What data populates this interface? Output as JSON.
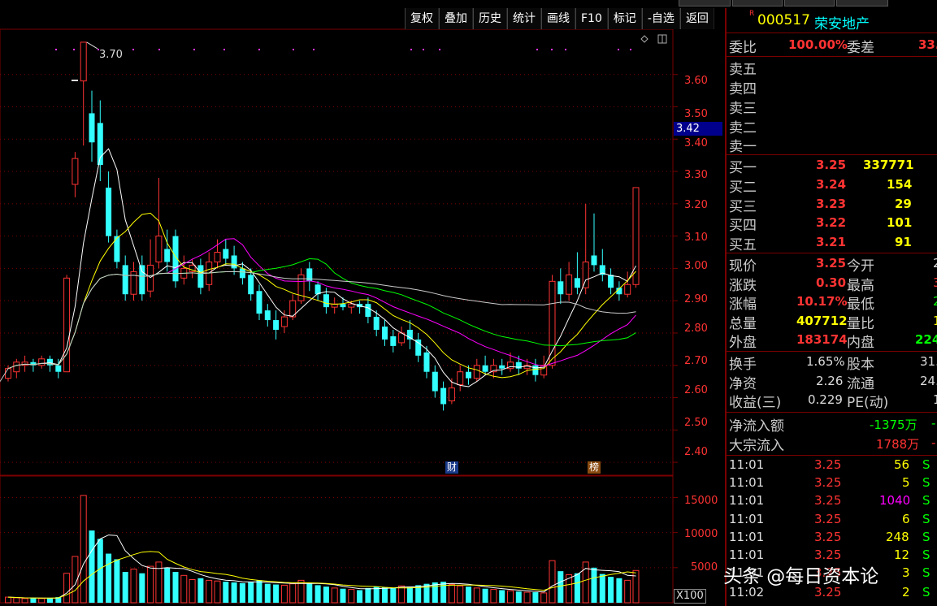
{
  "toolbar": {
    "items": [
      "复权",
      "叠加",
      "历史",
      "统计",
      "画线",
      "F10",
      "标记",
      "-自选",
      "返回"
    ]
  },
  "chart_data": {
    "type": "candlestick",
    "title": "",
    "price_axis": {
      "ticks": [
        "3.60",
        "3.50",
        "3.40",
        "3.30",
        "3.20",
        "3.10",
        "3.00",
        "2.90",
        "2.80",
        "2.70",
        "2.60",
        "2.50",
        "2.40"
      ],
      "range": [
        2.36,
        3.73
      ]
    },
    "volume_axis": {
      "ticks": [
        "15000",
        "10000",
        "5000"
      ],
      "multiplier_label": "X100",
      "range": [
        0,
        17600
      ]
    },
    "current_price_label": "3.42",
    "high_marker": "3.70",
    "event_badges": [
      {
        "label": "财",
        "index": 53,
        "color": "#1a3a8a"
      },
      {
        "label": "榜",
        "index": 70,
        "color": "#8a4a10"
      }
    ],
    "candles": [
      [
        2.66,
        2.69,
        2.7,
        2.65
      ],
      [
        2.68,
        2.71,
        2.72,
        2.66
      ],
      [
        2.7,
        2.71,
        2.73,
        2.68
      ],
      [
        2.71,
        2.7,
        2.72,
        2.68
      ],
      [
        2.7,
        2.72,
        2.73,
        2.69
      ],
      [
        2.72,
        2.7,
        2.73,
        2.68
      ],
      [
        2.7,
        2.68,
        2.72,
        2.66
      ],
      [
        2.68,
        2.97,
        2.98,
        2.68
      ],
      [
        3.26,
        3.34,
        3.36,
        3.22
      ],
      [
        3.58,
        3.7,
        3.7,
        3.38
      ],
      [
        3.48,
        3.39,
        3.55,
        3.33
      ],
      [
        3.45,
        3.32,
        3.52,
        3.27
      ],
      [
        3.25,
        3.1,
        3.3,
        3.08
      ],
      [
        3.1,
        3.02,
        3.12,
        3.0
      ],
      [
        3.01,
        2.92,
        3.04,
        2.9
      ],
      [
        2.92,
        2.99,
        3.02,
        2.9
      ],
      [
        3.01,
        2.92,
        3.04,
        2.9
      ],
      [
        2.93,
        3.01,
        3.09,
        2.91
      ],
      [
        3.02,
        3.1,
        3.28,
        3.0
      ],
      [
        3.06,
        3.02,
        3.12,
        2.99
      ],
      [
        3.1,
        2.96,
        3.12,
        2.94
      ],
      [
        2.97,
        3.0,
        3.04,
        2.95
      ],
      [
        2.99,
        3.01,
        3.03,
        2.97
      ],
      [
        3.01,
        2.94,
        3.03,
        2.92
      ],
      [
        2.95,
        3.02,
        3.05,
        2.93
      ],
      [
        3.02,
        3.05,
        3.09,
        3.0
      ],
      [
        3.06,
        3.03,
        3.09,
        3.01
      ],
      [
        3.04,
        3.0,
        3.07,
        2.98
      ],
      [
        3.0,
        2.97,
        3.02,
        2.95
      ],
      [
        2.98,
        2.92,
        3.0,
        2.9
      ],
      [
        2.93,
        2.86,
        2.95,
        2.84
      ],
      [
        2.87,
        2.84,
        2.89,
        2.82
      ],
      [
        2.84,
        2.81,
        2.87,
        2.78
      ],
      [
        2.82,
        2.85,
        2.87,
        2.8
      ],
      [
        2.85,
        2.9,
        2.92,
        2.84
      ],
      [
        2.9,
        2.98,
        3.0,
        2.89
      ],
      [
        3.0,
        2.96,
        3.02,
        2.93
      ],
      [
        2.95,
        2.92,
        2.96,
        2.9
      ],
      [
        2.92,
        2.88,
        2.94,
        2.86
      ],
      [
        2.88,
        2.89,
        2.91,
        2.86
      ],
      [
        2.89,
        2.88,
        2.91,
        2.87
      ],
      [
        2.88,
        2.89,
        2.9,
        2.86
      ],
      [
        2.89,
        2.88,
        2.9,
        2.86
      ],
      [
        2.89,
        2.85,
        2.91,
        2.83
      ],
      [
        2.85,
        2.81,
        2.87,
        2.79
      ],
      [
        2.82,
        2.78,
        2.84,
        2.76
      ],
      [
        2.79,
        2.76,
        2.81,
        2.74
      ],
      [
        2.77,
        2.8,
        2.82,
        2.76
      ],
      [
        2.81,
        2.78,
        2.84,
        2.75
      ],
      [
        2.78,
        2.73,
        2.8,
        2.71
      ],
      [
        2.74,
        2.68,
        2.76,
        2.66
      ],
      [
        2.68,
        2.62,
        2.7,
        2.6
      ],
      [
        2.63,
        2.58,
        2.65,
        2.56
      ],
      [
        2.59,
        2.63,
        2.66,
        2.58
      ],
      [
        2.64,
        2.68,
        2.7,
        2.62
      ],
      [
        2.68,
        2.66,
        2.7,
        2.64
      ],
      [
        2.66,
        2.7,
        2.72,
        2.65
      ],
      [
        2.7,
        2.68,
        2.73,
        2.67
      ],
      [
        2.68,
        2.7,
        2.72,
        2.66
      ],
      [
        2.7,
        2.69,
        2.72,
        2.67
      ],
      [
        2.69,
        2.71,
        2.74,
        2.68
      ],
      [
        2.71,
        2.69,
        2.73,
        2.67
      ],
      [
        2.69,
        2.7,
        2.72,
        2.67
      ],
      [
        2.7,
        2.67,
        2.72,
        2.65
      ],
      [
        2.67,
        2.7,
        2.73,
        2.66
      ],
      [
        2.7,
        2.96,
        2.98,
        2.69
      ],
      [
        2.96,
        2.92,
        3.0,
        2.89
      ],
      [
        2.92,
        2.98,
        3.02,
        2.9
      ],
      [
        2.97,
        2.94,
        3.05,
        2.92
      ],
      [
        2.94,
        3.02,
        3.2,
        2.92
      ],
      [
        3.04,
        3.01,
        3.17,
        2.99
      ],
      [
        3.01,
        2.98,
        3.06,
        2.96
      ],
      [
        2.98,
        2.94,
        3.0,
        2.92
      ],
      [
        2.94,
        2.92,
        2.96,
        2.9
      ],
      [
        2.92,
        2.95,
        2.99,
        2.91
      ],
      [
        2.95,
        3.25,
        3.25,
        2.94
      ]
    ],
    "volumes": [
      800,
      700,
      600,
      650,
      600,
      700,
      800,
      4200,
      6600,
      15300,
      10300,
      9100,
      7000,
      6200,
      4400,
      4800,
      4200,
      5200,
      5800,
      5000,
      4400,
      3900,
      3300,
      3500,
      3200,
      3100,
      3000,
      2900,
      2800,
      3000,
      3200,
      2700,
      2600,
      2500,
      2700,
      3200,
      2800,
      2500,
      2300,
      2100,
      2000,
      1900,
      1800,
      2100,
      2300,
      2200,
      2100,
      2400,
      2300,
      2500,
      2700,
      2900,
      3000,
      2600,
      2400,
      2300,
      2100,
      2000,
      1900,
      1800,
      1700,
      1600,
      1500,
      1500,
      1400,
      6000,
      4500,
      4000,
      4200,
      5800,
      5000,
      4100,
      3700,
      3500,
      3200,
      4600
    ]
  },
  "panel": {
    "header": {
      "r_mark": "R",
      "code": "000517",
      "name": "荣安地产"
    },
    "weibi": {
      "label": "委比",
      "value": "100.00%",
      "label2": "委差",
      "value2": "33."
    },
    "sell": [
      "卖五",
      "卖四",
      "卖三",
      "卖二",
      "卖一"
    ],
    "buy": [
      {
        "label": "买一",
        "price": "3.25",
        "vol": "337771"
      },
      {
        "label": "买二",
        "price": "3.24",
        "vol": "154"
      },
      {
        "label": "买三",
        "price": "3.23",
        "vol": "29"
      },
      {
        "label": "买四",
        "price": "3.22",
        "vol": "101"
      },
      {
        "label": "买五",
        "price": "3.21",
        "vol": "91"
      }
    ],
    "quote": [
      {
        "l1": "现价",
        "v1": "3.25",
        "l2": "今开",
        "v2": "2"
      },
      {
        "l1": "涨跌",
        "v1": "0.30",
        "l2": "最高",
        "v2": "3"
      },
      {
        "l1": "涨幅",
        "v1": "10.17%",
        "l2": "最低",
        "v2": "2"
      },
      {
        "l1": "总量",
        "v1": "407712",
        "l2": "量比",
        "v2": "1"
      },
      {
        "l1": "外盘",
        "v1": "183174",
        "l2": "内盘",
        "v2": "224"
      }
    ],
    "stats": [
      {
        "l1": "换手",
        "v1": "1.65%",
        "l2": "股本",
        "v2": "31."
      },
      {
        "l1": "净资",
        "v1": "2.26",
        "l2": "流通",
        "v2": "24."
      },
      {
        "l1": "收益(三)",
        "v1": "0.229",
        "l2": "PE(动)",
        "v2": "1"
      }
    ],
    "flow": [
      {
        "label": "净流入额",
        "value": "-1375万",
        "extra": "-"
      },
      {
        "label": "大宗流入",
        "value": "1788万",
        "extra": "-"
      }
    ],
    "ticks": [
      {
        "t": "11:01",
        "p": "3.25",
        "v": "56",
        "s": "S",
        "c": "yel"
      },
      {
        "t": "11:01",
        "p": "3.25",
        "v": "5",
        "s": "S",
        "c": "yel"
      },
      {
        "t": "11:01",
        "p": "3.25",
        "v": "1040",
        "s": "S",
        "c": "mag"
      },
      {
        "t": "11:01",
        "p": "3.25",
        "v": "6",
        "s": "S",
        "c": "yel"
      },
      {
        "t": "11:01",
        "p": "3.25",
        "v": "248",
        "s": "S",
        "c": "yel"
      },
      {
        "t": "11:01",
        "p": "3.25",
        "v": "12",
        "s": "S",
        "c": "yel"
      },
      {
        "t": "11:01",
        "p": "3.25",
        "v": "3",
        "s": "S",
        "c": "yel"
      },
      {
        "t": "11:02",
        "p": "3.25",
        "v": "2",
        "s": "S",
        "c": "yel"
      }
    ]
  },
  "watermark": "头条 @每日资本论",
  "colors": {
    "up": "#ff3333",
    "down": "#33ffff",
    "grid": "#7a0000",
    "ma5": "#ffffff",
    "ma10": "#ffff00",
    "ma20": "#ff00ff",
    "ma30": "#00ff00",
    "ma60": "#cccccc"
  }
}
